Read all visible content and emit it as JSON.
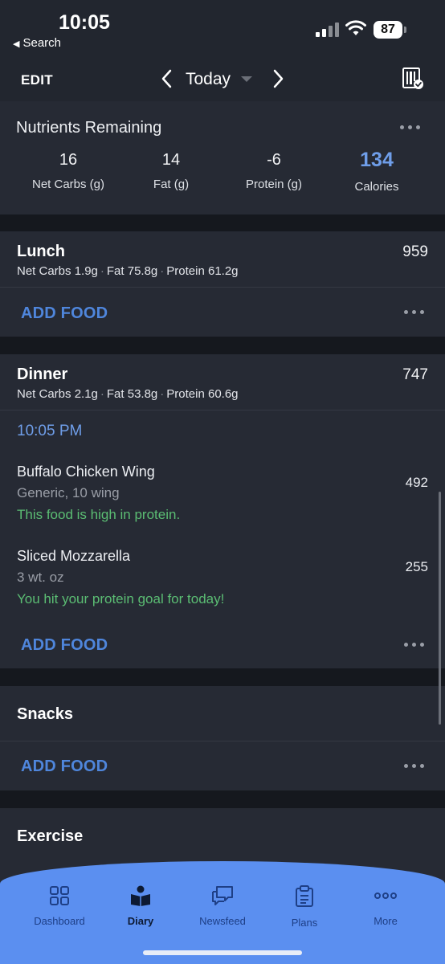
{
  "status_bar": {
    "time": "10:05",
    "back_label": "Search",
    "battery": "87"
  },
  "header": {
    "edit_label": "EDIT",
    "date_label": "Today"
  },
  "nutrients": {
    "title": "Nutrients Remaining",
    "columns": [
      {
        "value": "16",
        "label": "Net Carbs (g)"
      },
      {
        "value": "14",
        "label": "Fat (g)"
      },
      {
        "value": "-6",
        "label": "Protein (g)"
      },
      {
        "value": "134",
        "label": "Calories"
      }
    ]
  },
  "lunch": {
    "title": "Lunch",
    "calories": "959",
    "macros": [
      "Net Carbs 1.9g",
      "Fat 75.8g",
      "Protein 61.2g"
    ],
    "add_food_label": "ADD FOOD"
  },
  "dinner": {
    "title": "Dinner",
    "calories": "747",
    "macros": [
      "Net Carbs 2.1g",
      "Fat 53.8g",
      "Protein 60.6g"
    ],
    "time": "10:05 PM",
    "foods": [
      {
        "name": "Buffalo Chicken Wing",
        "detail": "Generic, 10 wing",
        "note": "This food is high in protein.",
        "calories": "492"
      },
      {
        "name": "Sliced Mozzarella",
        "detail": "3 wt. oz",
        "note": "You hit your protein goal for today!",
        "calories": "255"
      }
    ],
    "add_food_label": "ADD FOOD"
  },
  "snacks": {
    "title": "Snacks",
    "add_food_label": "ADD FOOD"
  },
  "exercise": {
    "title": "Exercise"
  },
  "tabbar": {
    "tabs": [
      {
        "label": "Dashboard",
        "icon": "dashboard-grid-icon"
      },
      {
        "label": "Diary",
        "icon": "diary-book-icon",
        "active": true
      },
      {
        "label": "Newsfeed",
        "icon": "newsfeed-chat-icon"
      },
      {
        "label": "Plans",
        "icon": "plans-clipboard-icon"
      },
      {
        "label": "More",
        "icon": "more-dots-icon"
      }
    ]
  },
  "colors": {
    "accent": "#5b8ff0",
    "link": "#4f86dc",
    "success": "#5bbd73",
    "card": "#262a34",
    "background": "#15181e"
  }
}
